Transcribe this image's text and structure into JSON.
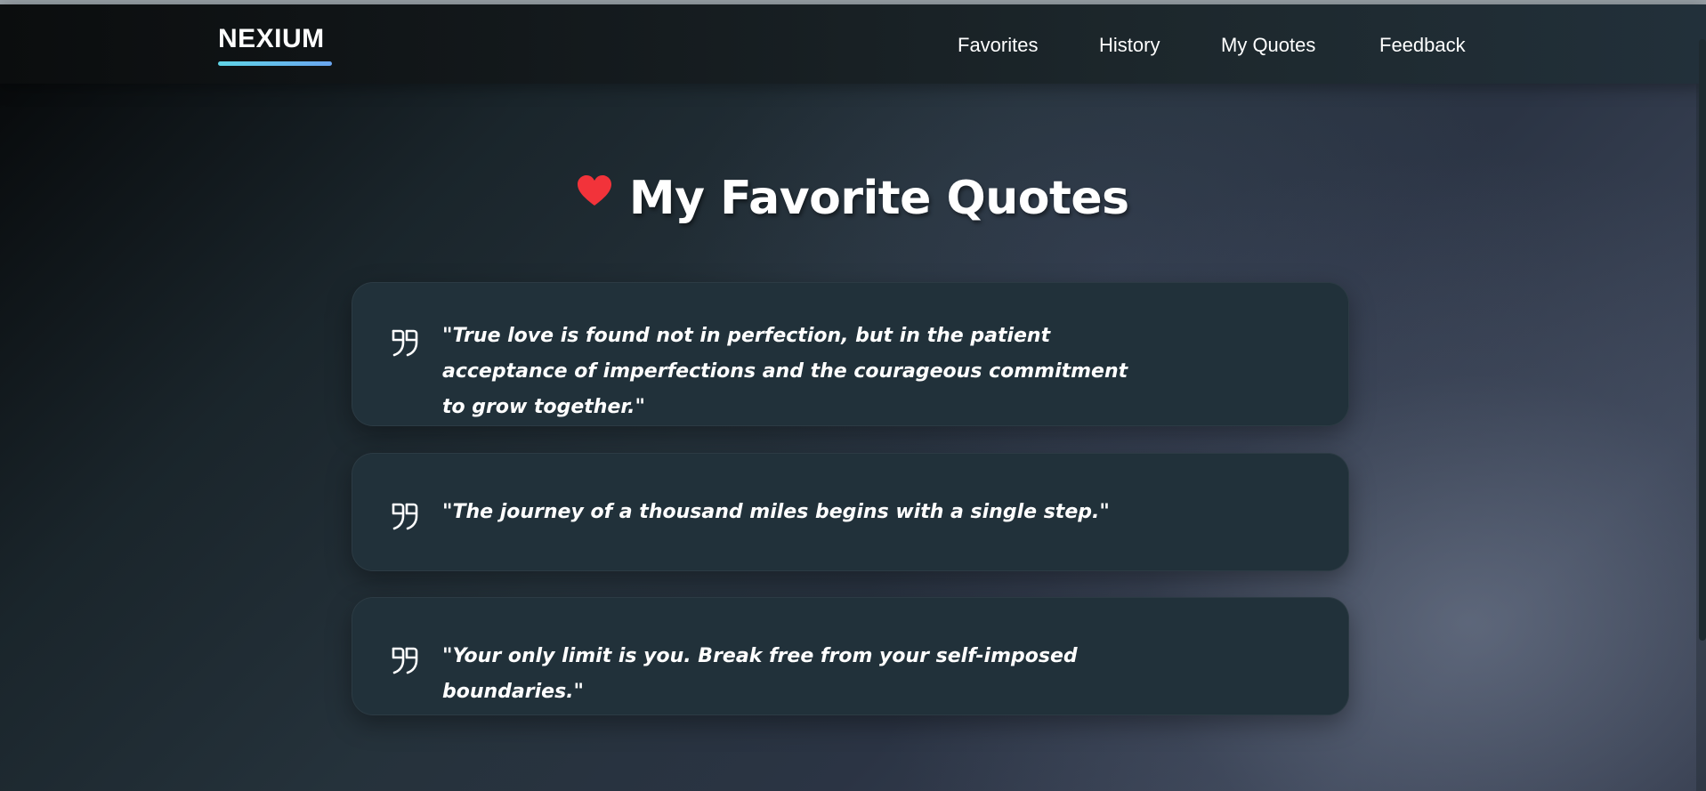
{
  "header": {
    "brand": "NEXIUM",
    "brand_accent": "#5fd4e6",
    "nav": [
      {
        "label": "Favorites"
      },
      {
        "label": "History"
      },
      {
        "label": "My Quotes"
      },
      {
        "label": "Feedback"
      }
    ]
  },
  "main": {
    "heading": "My Favorite Quotes",
    "heading_icon": "heart-icon",
    "heart_color": "#f2333a",
    "quotes": [
      {
        "text": "\"True love is found not in perfection, but in the patient acceptance of imperfections and the courageous commitment to grow together.\"",
        "icon": "quote-mark-icon"
      },
      {
        "text": "\"The journey of a thousand miles begins with a single step.\"",
        "icon": "quote-mark-icon"
      },
      {
        "text": "\"Your only limit is you. Break free from your self-imposed boundaries.\"",
        "icon": "quote-mark-icon"
      }
    ]
  }
}
